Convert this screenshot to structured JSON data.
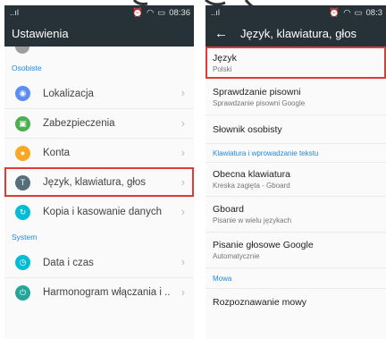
{
  "left": {
    "statusbar": {
      "signal": "..ıl",
      "time": "08:36"
    },
    "title": "Ustawienia",
    "sections": [
      {
        "label": "Osobiste"
      },
      {
        "label": "System"
      }
    ],
    "personal_items": [
      {
        "label": "Lokalizacja",
        "color": "#5c8df6",
        "icon": "location-icon"
      },
      {
        "label": "Zabezpieczenia",
        "color": "#4caf50",
        "icon": "lock-icon"
      },
      {
        "label": "Konta",
        "color": "#f9a825",
        "icon": "account-icon"
      },
      {
        "label": "Język, klawiatura, głos",
        "color": "#546e7a",
        "icon": "language-icon"
      },
      {
        "label": "Kopia i kasowanie danych",
        "color": "#00bcd4",
        "icon": "backup-icon"
      }
    ],
    "system_items": [
      {
        "label": "Data i czas",
        "color": "#00bcd4",
        "icon": "clock-icon"
      },
      {
        "label": "Harmonogram włączania i ..",
        "color": "#26a69a",
        "icon": "power-schedule-icon"
      }
    ]
  },
  "right": {
    "statusbar": {
      "signal": "..ıl",
      "time": "08:3"
    },
    "title": "Język, klawiatura, głos",
    "items": [
      {
        "title": "Język",
        "subtitle": "Polski"
      },
      {
        "title": "Sprawdzanie pisowni",
        "subtitle": "Sprawdzanie pisowni Google"
      },
      {
        "title": "Słownik osobisty",
        "subtitle": ""
      }
    ],
    "keyboard_section": "Klawiatura i wprowadzanie tekstu",
    "keyboard_items": [
      {
        "title": "Obecna klawiatura",
        "subtitle": "Kreska zagięta - Gboard"
      },
      {
        "title": "Gboard",
        "subtitle": "Pisanie w wielu językach"
      },
      {
        "title": "Pisanie głosowe Google",
        "subtitle": "Automatycznie"
      }
    ],
    "speech_section": "Mowa",
    "speech_items": [
      {
        "title": "Rozpoznawanie mowy",
        "subtitle": ""
      }
    ]
  }
}
